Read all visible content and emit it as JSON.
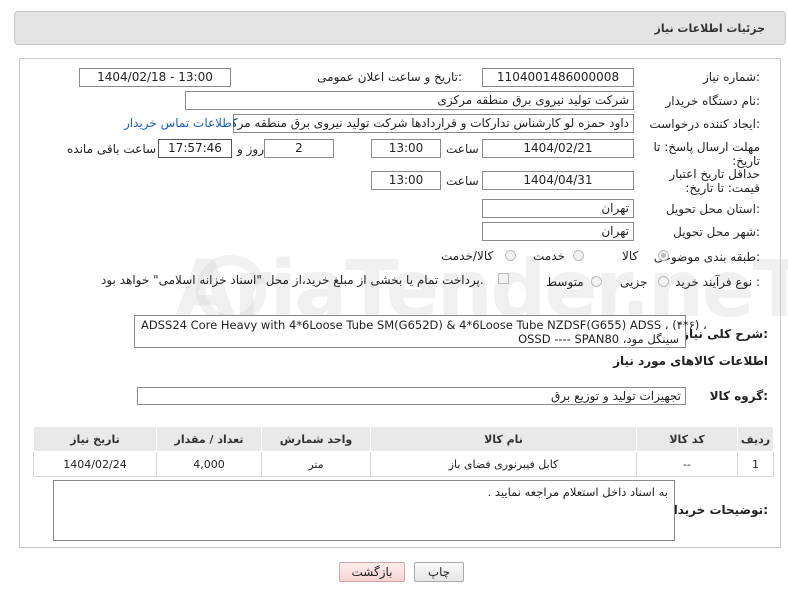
{
  "header": {
    "title": "جزئیات اطلاعات نیاز"
  },
  "form": {
    "need_number_label": "شماره نیاز:",
    "need_number": "1104001486000008",
    "announce_label": "تاریخ و ساعت اعلان عمومی:",
    "announce_value": "1404/02/18 - 13:00",
    "buyer_label": "نام دستگاه خریدار:",
    "buyer_value": "شرکت تولید نیروی برق منطقه مرکزی",
    "creator_label": "ایجاد کننده درخواست:",
    "creator_value": "داود حمزه لو کارشناس تدارکات و قراردادها شرکت تولید نیروی برق منطقه مرکزی",
    "contact_link": "اطلاعات تماس خریدار",
    "deadline_label": "مهلت ارسال پاسخ: تا تاریخ:",
    "deadline_date": "1404/02/21",
    "time_label": "ساعت",
    "deadline_time": "13:00",
    "days_value": "2",
    "days_label": "روز و",
    "remaining_value": "17:57:46",
    "remaining_label": "ساعت باقی مانده",
    "price_label": "حداقل تاریخ اعتبار قیمت: تا تاریخ:",
    "price_date": "1404/04/31",
    "price_time": "13:00",
    "province_label": "استان محل تحویل:",
    "province_value": "تهران",
    "city_label": "شهر محل تحویل:",
    "city_value": "تهران",
    "category_label": "طبقه بندی موضوعی:",
    "category_options": [
      "کالا",
      "خدمت",
      "کالا/خدمت"
    ],
    "process_label": "نوع فرآیند خرید :",
    "process_options": [
      "جزیی",
      "متوسط"
    ],
    "payment_note": "پرداخت تمام یا بخشی از مبلغ خرید،از محل \"اسناد خزانه اسلامی\" خواهد بود.",
    "summary_label": "شرح کلی نیاز:",
    "summary_line1": "ADSS24 Core Heavy with 4*6Loose Tube SM(G652D)  & 4*6Loose Tube NZDSF(G655) ADSS ، (۴*۶) ،",
    "summary_line2": "سینگل مود، OSSD ---- SPAN80",
    "goods_info_title": "اطلاعات کالاهای مورد نیاز",
    "goods_group_label": "گروه کالا:",
    "goods_group_value": "تجهیزات تولید و توزیع برق"
  },
  "table": {
    "headers": [
      "ردیف",
      "کد کالا",
      "نام کالا",
      "واحد شمارش",
      "تعداد / مقدار",
      "تاریخ نیاز"
    ],
    "rows": [
      [
        "1",
        "--",
        "کابل فیبرنوری فضای باز",
        "متر",
        "4,000",
        "1404/02/24"
      ]
    ]
  },
  "notes": {
    "label": "توضیحات خریدار:",
    "value": "به اسناد داخل استعلام مراجعه نمایید ."
  },
  "buttons": {
    "print": "چاپ",
    "back": "بازگشت"
  },
  "watermark": "AriaTender.neT"
}
